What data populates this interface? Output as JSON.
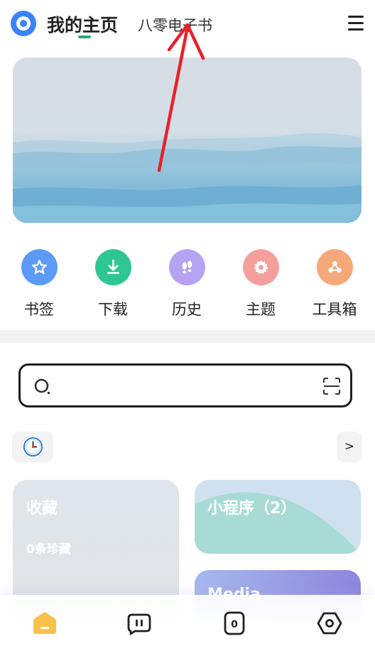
{
  "header": {
    "tabs": [
      {
        "label": "我的主页",
        "active": true
      },
      {
        "label": "八零电子书",
        "active": false
      }
    ]
  },
  "shortcuts": [
    {
      "label": "书签",
      "icon": "star-icon",
      "color": "#5b9af5"
    },
    {
      "label": "下载",
      "icon": "download-icon",
      "color": "#2ec78f"
    },
    {
      "label": "历史",
      "icon": "footprint-icon",
      "color": "#b5a2f3"
    },
    {
      "label": "主题",
      "icon": "gear-icon",
      "color": "#f59f9d"
    },
    {
      "label": "工具箱",
      "icon": "toolbox-icon",
      "color": "#f5a97b"
    }
  ],
  "search": {
    "placeholder": ""
  },
  "more_label": ">",
  "cards": {
    "favorites": {
      "title": "收藏",
      "subtitle": "0条珍藏"
    },
    "mini_programs": {
      "title": "小程序（2）"
    },
    "media": {
      "title": "Media"
    }
  },
  "colors": {
    "accent": "#20b070",
    "brand_blue": "#3a83f7",
    "annotation_red": "#e8212a",
    "home_yellow": "#f8c24a"
  }
}
